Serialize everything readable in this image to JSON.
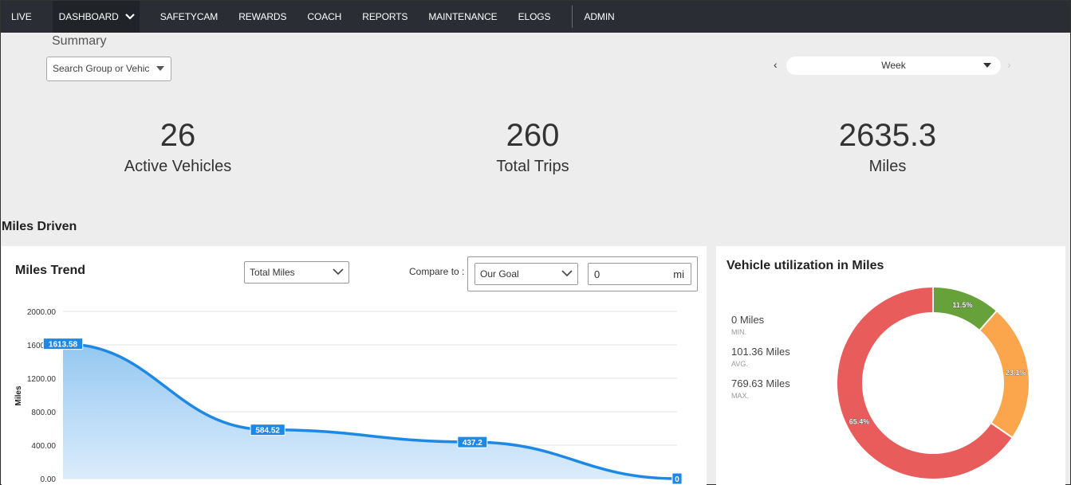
{
  "nav": {
    "items": [
      "LIVE",
      "DASHBOARD",
      "SAFETYCAM",
      "REWARDS",
      "COACH",
      "REPORTS",
      "MAINTENANCE",
      "ELOGS"
    ],
    "admin": "ADMIN",
    "colors": {
      "bar": "#2a2d33",
      "active": "#202327"
    }
  },
  "summary": {
    "title": "Summary",
    "search_value": "Search Group or Vehic",
    "period": "Week",
    "prev_icon": "chevron-left-icon",
    "next_icon": "chevron-right-icon"
  },
  "stats": [
    {
      "value": "26",
      "label": "Active Vehicles"
    },
    {
      "value": "260",
      "label": "Total Trips"
    },
    {
      "value": "2635.3",
      "label": "Miles"
    }
  ],
  "miles_driven": {
    "section_title": "Miles Driven",
    "trend": {
      "title": "Miles Trend",
      "metric_select": "Total Miles",
      "compare_label": "Compare to :",
      "compare_select": "Our Goal",
      "goal_value": "0",
      "goal_unit": "mi"
    },
    "utilization": {
      "title": "Vehicle utilization in Miles",
      "min_value": "0 Miles",
      "min_label": "MIN.",
      "avg_value": "101.36 Miles",
      "avg_label": "AVG.",
      "max_value": "769.63 Miles",
      "max_label": "MAX."
    }
  },
  "chart_data": [
    {
      "type": "area",
      "title": "Miles Trend",
      "ylabel": "Miles",
      "ylim": [
        0,
        2000
      ],
      "yticks": [
        "2000.00",
        "1600.00",
        "1200.00",
        "800.00",
        "400.00",
        "0.00"
      ],
      "series": [
        {
          "values": [
            1613.58,
            584.52,
            437.2,
            0
          ],
          "labels": [
            "1613.58",
            "584.52",
            "437.2",
            "0"
          ]
        }
      ],
      "colors": {
        "line": "#1e88e5",
        "label_bg": "#1e88e5"
      },
      "grid": true
    },
    {
      "type": "pie",
      "title": "Vehicle utilization in Miles",
      "slices": [
        {
          "value": 11.5,
          "label": "11.5%",
          "color": "#67a139"
        },
        {
          "value": 23.1,
          "label": "23.1%",
          "color": "#fba54d"
        },
        {
          "value": 65.4,
          "label": "65.4%",
          "color": "#e85c5c"
        }
      ]
    }
  ]
}
